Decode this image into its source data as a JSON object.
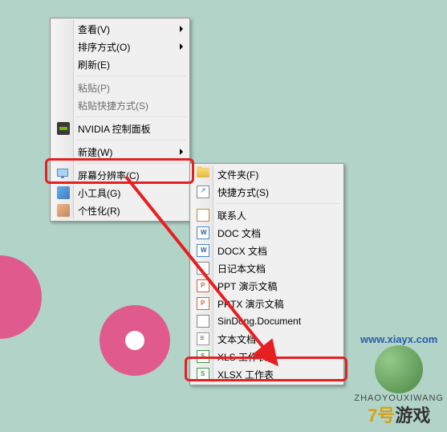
{
  "menu1": {
    "items": [
      {
        "label": "查看(V)",
        "arrow": true
      },
      {
        "label": "排序方式(O)",
        "arrow": true
      },
      {
        "label": "刷新(E)"
      },
      {
        "sep": true
      },
      {
        "label": "粘贴(P)",
        "disabled": true
      },
      {
        "label": "粘贴快捷方式(S)",
        "disabled": true
      },
      {
        "sep": true
      },
      {
        "label": "NVIDIA 控制面板",
        "icon": "nvidia-icon"
      },
      {
        "sep": true
      },
      {
        "label": "新建(W)",
        "arrow": true,
        "highlight": true
      },
      {
        "sep": true
      },
      {
        "label": "屏幕分辨率(C)",
        "icon": "monitor-icon"
      },
      {
        "label": "小工具(G)",
        "icon": "gadget-icon"
      },
      {
        "label": "个性化(R)",
        "icon": "personalize-icon"
      }
    ]
  },
  "menu2": {
    "items": [
      {
        "label": "文件夹(F)",
        "icon": "folder-icon"
      },
      {
        "label": "快捷方式(S)",
        "icon": "shortcut-icon"
      },
      {
        "sep": true
      },
      {
        "label": "联系人",
        "icon": "contact-icon"
      },
      {
        "label": "DOC 文档",
        "icon": "doc-icon"
      },
      {
        "label": "DOCX 文档",
        "icon": "docx-icon"
      },
      {
        "label": "日记本文档",
        "icon": "diary-icon"
      },
      {
        "label": "PPT 演示文稿",
        "icon": "ppt-icon"
      },
      {
        "label": "PPTX 演示文稿",
        "icon": "pptx-icon"
      },
      {
        "label": "SinDong.Document",
        "icon": "sd-icon"
      },
      {
        "label": "文本文档",
        "icon": "txt-icon"
      },
      {
        "label": "XLS 工作表",
        "icon": "xls-icon",
        "highlight": true
      },
      {
        "label": "XLSX 工作表",
        "icon": "xlsx-icon"
      }
    ]
  },
  "watermark": {
    "url": "www.xiayx.com",
    "pinyin": "ZHAOYOUXIWANG",
    "brand_prefix": "7号",
    "brand_suffix": "游戏"
  },
  "annotation": {
    "arrow_color": "#e62020",
    "highlight_color": "#e62020"
  }
}
